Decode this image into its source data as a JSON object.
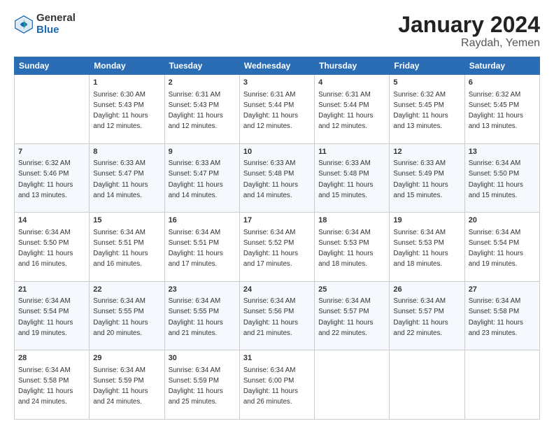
{
  "logo": {
    "general": "General",
    "blue": "Blue"
  },
  "header": {
    "title": "January 2024",
    "subtitle": "Raydah, Yemen"
  },
  "calendar": {
    "columns": [
      "Sunday",
      "Monday",
      "Tuesday",
      "Wednesday",
      "Thursday",
      "Friday",
      "Saturday"
    ],
    "weeks": [
      [
        {
          "day": "",
          "sunrise": "",
          "sunset": "",
          "daylight": ""
        },
        {
          "day": "1",
          "sunrise": "Sunrise: 6:30 AM",
          "sunset": "Sunset: 5:43 PM",
          "daylight": "Daylight: 11 hours and 12 minutes."
        },
        {
          "day": "2",
          "sunrise": "Sunrise: 6:31 AM",
          "sunset": "Sunset: 5:43 PM",
          "daylight": "Daylight: 11 hours and 12 minutes."
        },
        {
          "day": "3",
          "sunrise": "Sunrise: 6:31 AM",
          "sunset": "Sunset: 5:44 PM",
          "daylight": "Daylight: 11 hours and 12 minutes."
        },
        {
          "day": "4",
          "sunrise": "Sunrise: 6:31 AM",
          "sunset": "Sunset: 5:44 PM",
          "daylight": "Daylight: 11 hours and 12 minutes."
        },
        {
          "day": "5",
          "sunrise": "Sunrise: 6:32 AM",
          "sunset": "Sunset: 5:45 PM",
          "daylight": "Daylight: 11 hours and 13 minutes."
        },
        {
          "day": "6",
          "sunrise": "Sunrise: 6:32 AM",
          "sunset": "Sunset: 5:45 PM",
          "daylight": "Daylight: 11 hours and 13 minutes."
        }
      ],
      [
        {
          "day": "7",
          "sunrise": "Sunrise: 6:32 AM",
          "sunset": "Sunset: 5:46 PM",
          "daylight": "Daylight: 11 hours and 13 minutes."
        },
        {
          "day": "8",
          "sunrise": "Sunrise: 6:33 AM",
          "sunset": "Sunset: 5:47 PM",
          "daylight": "Daylight: 11 hours and 14 minutes."
        },
        {
          "day": "9",
          "sunrise": "Sunrise: 6:33 AM",
          "sunset": "Sunset: 5:47 PM",
          "daylight": "Daylight: 11 hours and 14 minutes."
        },
        {
          "day": "10",
          "sunrise": "Sunrise: 6:33 AM",
          "sunset": "Sunset: 5:48 PM",
          "daylight": "Daylight: 11 hours and 14 minutes."
        },
        {
          "day": "11",
          "sunrise": "Sunrise: 6:33 AM",
          "sunset": "Sunset: 5:48 PM",
          "daylight": "Daylight: 11 hours and 15 minutes."
        },
        {
          "day": "12",
          "sunrise": "Sunrise: 6:33 AM",
          "sunset": "Sunset: 5:49 PM",
          "daylight": "Daylight: 11 hours and 15 minutes."
        },
        {
          "day": "13",
          "sunrise": "Sunrise: 6:34 AM",
          "sunset": "Sunset: 5:50 PM",
          "daylight": "Daylight: 11 hours and 15 minutes."
        }
      ],
      [
        {
          "day": "14",
          "sunrise": "Sunrise: 6:34 AM",
          "sunset": "Sunset: 5:50 PM",
          "daylight": "Daylight: 11 hours and 16 minutes."
        },
        {
          "day": "15",
          "sunrise": "Sunrise: 6:34 AM",
          "sunset": "Sunset: 5:51 PM",
          "daylight": "Daylight: 11 hours and 16 minutes."
        },
        {
          "day": "16",
          "sunrise": "Sunrise: 6:34 AM",
          "sunset": "Sunset: 5:51 PM",
          "daylight": "Daylight: 11 hours and 17 minutes."
        },
        {
          "day": "17",
          "sunrise": "Sunrise: 6:34 AM",
          "sunset": "Sunset: 5:52 PM",
          "daylight": "Daylight: 11 hours and 17 minutes."
        },
        {
          "day": "18",
          "sunrise": "Sunrise: 6:34 AM",
          "sunset": "Sunset: 5:53 PM",
          "daylight": "Daylight: 11 hours and 18 minutes."
        },
        {
          "day": "19",
          "sunrise": "Sunrise: 6:34 AM",
          "sunset": "Sunset: 5:53 PM",
          "daylight": "Daylight: 11 hours and 18 minutes."
        },
        {
          "day": "20",
          "sunrise": "Sunrise: 6:34 AM",
          "sunset": "Sunset: 5:54 PM",
          "daylight": "Daylight: 11 hours and 19 minutes."
        }
      ],
      [
        {
          "day": "21",
          "sunrise": "Sunrise: 6:34 AM",
          "sunset": "Sunset: 5:54 PM",
          "daylight": "Daylight: 11 hours and 19 minutes."
        },
        {
          "day": "22",
          "sunrise": "Sunrise: 6:34 AM",
          "sunset": "Sunset: 5:55 PM",
          "daylight": "Daylight: 11 hours and 20 minutes."
        },
        {
          "day": "23",
          "sunrise": "Sunrise: 6:34 AM",
          "sunset": "Sunset: 5:55 PM",
          "daylight": "Daylight: 11 hours and 21 minutes."
        },
        {
          "day": "24",
          "sunrise": "Sunrise: 6:34 AM",
          "sunset": "Sunset: 5:56 PM",
          "daylight": "Daylight: 11 hours and 21 minutes."
        },
        {
          "day": "25",
          "sunrise": "Sunrise: 6:34 AM",
          "sunset": "Sunset: 5:57 PM",
          "daylight": "Daylight: 11 hours and 22 minutes."
        },
        {
          "day": "26",
          "sunrise": "Sunrise: 6:34 AM",
          "sunset": "Sunset: 5:57 PM",
          "daylight": "Daylight: 11 hours and 22 minutes."
        },
        {
          "day": "27",
          "sunrise": "Sunrise: 6:34 AM",
          "sunset": "Sunset: 5:58 PM",
          "daylight": "Daylight: 11 hours and 23 minutes."
        }
      ],
      [
        {
          "day": "28",
          "sunrise": "Sunrise: 6:34 AM",
          "sunset": "Sunset: 5:58 PM",
          "daylight": "Daylight: 11 hours and 24 minutes."
        },
        {
          "day": "29",
          "sunrise": "Sunrise: 6:34 AM",
          "sunset": "Sunset: 5:59 PM",
          "daylight": "Daylight: 11 hours and 24 minutes."
        },
        {
          "day": "30",
          "sunrise": "Sunrise: 6:34 AM",
          "sunset": "Sunset: 5:59 PM",
          "daylight": "Daylight: 11 hours and 25 minutes."
        },
        {
          "day": "31",
          "sunrise": "Sunrise: 6:34 AM",
          "sunset": "Sunset: 6:00 PM",
          "daylight": "Daylight: 11 hours and 26 minutes."
        },
        {
          "day": "",
          "sunrise": "",
          "sunset": "",
          "daylight": ""
        },
        {
          "day": "",
          "sunrise": "",
          "sunset": "",
          "daylight": ""
        },
        {
          "day": "",
          "sunrise": "",
          "sunset": "",
          "daylight": ""
        }
      ]
    ]
  }
}
